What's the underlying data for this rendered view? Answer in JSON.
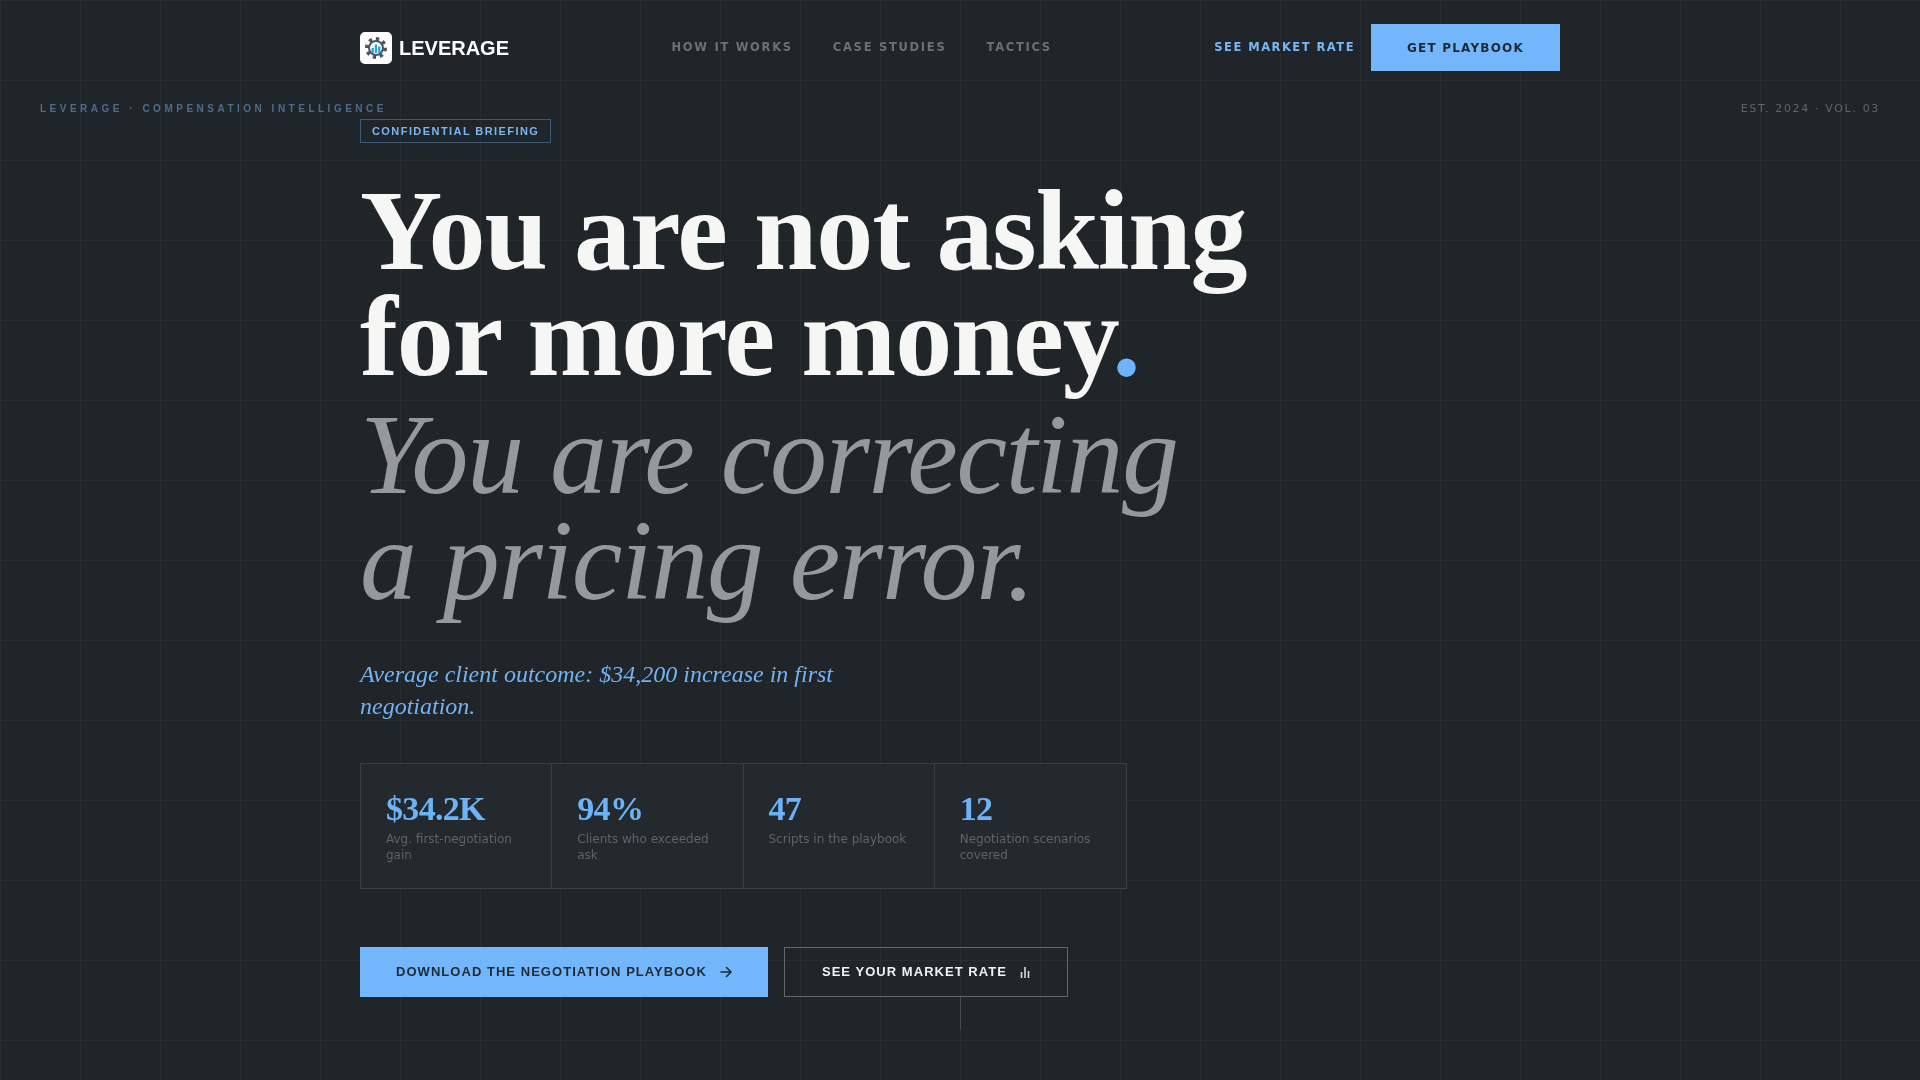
{
  "nav": {
    "brand": "LEVERAGE",
    "links": [
      "HOW IT WORKS",
      "CASE STUDIES",
      "TACTICS"
    ],
    "secondary_link": "SEE MARKET RATE",
    "cta": "GET PLAYBOOK"
  },
  "corner_labels": {
    "left": "LEVERAGE · COMPENSATION INTELLIGENCE",
    "right": "EST. 2024 · VOL. 03"
  },
  "hero": {
    "badge": "CONFIDENTIAL BRIEFING",
    "statement_lines": [
      "You are not asking",
      "for more money"
    ],
    "accent": ".",
    "reframe_lines": [
      "You are correcting",
      "a pricing error."
    ],
    "outcome": "Average client outcome: $34,200 increase in first negotiation.",
    "stats": [
      {
        "value": "$34.2K",
        "label": "Avg. first-negotiation gain"
      },
      {
        "value": "94%",
        "label": "Clients who exceeded ask"
      },
      {
        "value": "47",
        "label": "Scripts in the playbook"
      },
      {
        "value": "12",
        "label": "Negotiation scenarios covered"
      }
    ],
    "actions": [
      {
        "kind": "primary",
        "label": "DOWNLOAD THE NEGOTIATION PLAYBOOK"
      },
      {
        "kind": "outline",
        "label": "SEE YOUR MARKET RATE"
      }
    ]
  }
}
